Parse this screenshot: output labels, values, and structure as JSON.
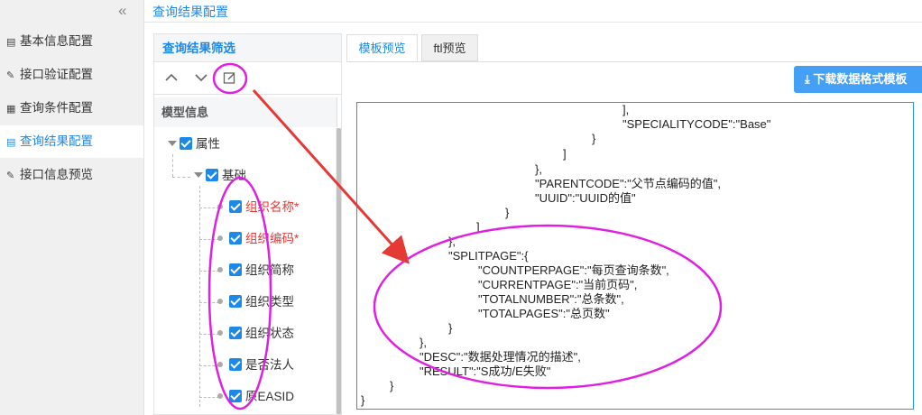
{
  "sidebar": {
    "collapse_glyph": "«",
    "items": [
      {
        "label": "基本信息配置",
        "icon": "document-icon"
      },
      {
        "label": "接口验证配置",
        "icon": "pen-icon"
      },
      {
        "label": "查询条件配置",
        "icon": "grid-icon"
      },
      {
        "label": "查询结果配置",
        "icon": "list-icon",
        "active": true
      },
      {
        "label": "接口信息预览",
        "icon": "preview-icon"
      }
    ]
  },
  "page": {
    "title": "查询结果配置"
  },
  "filter_panel": {
    "title": "查询结果筛选",
    "tree_header": "模型信息",
    "nodes": {
      "root": "属性",
      "group": "基础",
      "fields": [
        "组织名称*",
        "组织编码*",
        "组织简称",
        "组织类型",
        "组织状态",
        "是否法人",
        "原EASID"
      ]
    }
  },
  "tabs": [
    "模板预览",
    "ftl预览"
  ],
  "download_button": {
    "label": "下载数据格式模板"
  },
  "code": {
    "lines": [
      "],",
      "\"SPECIALITYCODE\":\"Base\"",
      "}",
      "]",
      "},",
      "\"PARENTCODE\":\"父节点编码的值\",",
      "\"UUID\":\"UUID的值\"",
      "}",
      "]",
      "},",
      "\"SPLITPAGE\":{",
      "\"COUNTPERPAGE\":\"每页查询条数\",",
      "\"CURRENTPAGE\":\"当前页码\",",
      "\"TOTALNUMBER\":\"总条数\",",
      "\"TOTALPAGES\":\"总页数\"",
      "}",
      "},",
      "\"DESC\":\"数据处理情况的描述\",",
      "\"RESULT\":\"S成功/E失败\"",
      "}",
      "}"
    ]
  },
  "colors": {
    "accent": "#1e88e5",
    "required": "#e53935",
    "annotation": "#e020e0",
    "arrow": "#e53935"
  }
}
